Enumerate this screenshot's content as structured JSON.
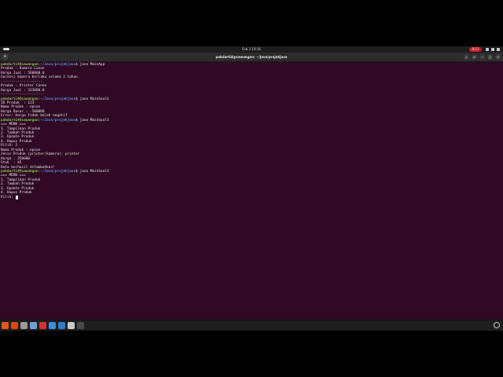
{
  "topbar": {
    "clock": "Feb 3  10:16",
    "recording": "0:11"
  },
  "window": {
    "title": "pakdarti4@sawangan: ~/Java/projekjava",
    "new_tab": "+"
  },
  "terminal": {
    "prompt_user": "pakdarti4@sawangan",
    "prompt_path": "~/Java/projekjava",
    "output": [
      {
        "cmd": "java MainApp"
      },
      {
        "text": "Produk : Kamera Canon"
      },
      {
        "text": "Harga Jual : 560000.0"
      },
      {
        "text": "Garansi kamera berlaku selama 2 tahun."
      },
      {
        "text": "--------------------"
      },
      {
        "text": "Produk : Printer Canon"
      },
      {
        "text": "Harga Jual : 323000.0"
      },
      {
        "text": "--------------------"
      },
      {
        "cmd": "java MainSoal2"
      },
      {
        "text": "ID Produk  : 123"
      },
      {
        "text": "Nama Produk : epson"
      },
      {
        "text": "Harga Dasar : -500000"
      },
      {
        "text": "Error: Harga tidak boleh negatif"
      },
      {
        "cmd": "java MainSoal3"
      },
      {
        "text": "=== MENU ==="
      },
      {
        "text": "1. Tampilkan Produk"
      },
      {
        "text": "2. Tambah Produk"
      },
      {
        "text": "3. Update Produk"
      },
      {
        "text": "4. Hapus Produk"
      },
      {
        "text": "Pilih: 2"
      },
      {
        "text": "Nama Produk : epson"
      },
      {
        "text": "Jenis Produk (printer/kamera): printer"
      },
      {
        "text": "Harga : 250000"
      },
      {
        "text": "Stok  : 45"
      },
      {
        "text": "Data berhasil ditambahkan!"
      },
      {
        "cmd": "java MainSoal3"
      },
      {
        "text": "=== MENU ==="
      },
      {
        "text": "1. Tampilkan Produk"
      },
      {
        "text": "2. Tambah Produk"
      },
      {
        "text": "3. Update Produk"
      },
      {
        "text": "4. Hapus Produk"
      },
      {
        "text": "Pilih: ",
        "cursor": true
      }
    ]
  },
  "taskbar": {
    "apps": [
      {
        "icon": "ubuntu-icon",
        "color": "#e95420"
      },
      {
        "icon": "firefox-icon",
        "color": "#d9480f"
      },
      {
        "icon": "files-icon",
        "color": "#9a9a9a"
      },
      {
        "icon": "text-editor-icon",
        "color": "#6ea0d8"
      },
      {
        "icon": "pdf-viewer-icon",
        "color": "#d63030"
      },
      {
        "icon": "chrome-icon",
        "color": "#3d8be0"
      },
      {
        "icon": "vscode-icon",
        "color": "#2b7bd1"
      },
      {
        "icon": "settings-icon",
        "color": "#c9c9c9"
      },
      {
        "icon": "terminal-icon",
        "color": "#4a4a4a"
      }
    ]
  }
}
